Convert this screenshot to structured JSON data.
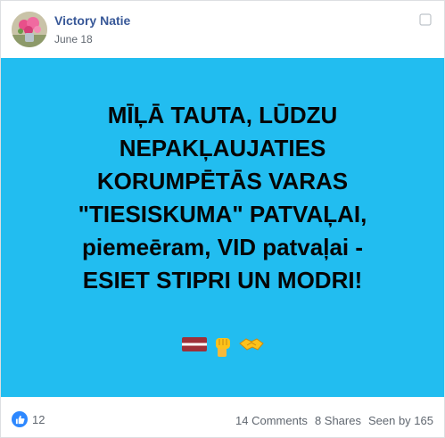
{
  "post": {
    "author": "Victory Natie",
    "date": "June 18",
    "text": "MĪĻĀ TAUTA, LŪDZU\nNEPAKĻAUJATIES\nKORUMPĒTĀS VARAS\n\"TIESISKUMA\" PATVAĻAI,\npiemeēram, VID patvaļai -\nESIET STIPRI UN MODRI!",
    "background_color": "#22bdf0",
    "emojis": [
      "latvia-flag-icon",
      "raised-fist-icon",
      "handshake-icon"
    ]
  },
  "footer": {
    "reaction_count": "12",
    "comments": "14 Comments",
    "shares": "8 Shares",
    "seen_by": "Seen by 165"
  }
}
